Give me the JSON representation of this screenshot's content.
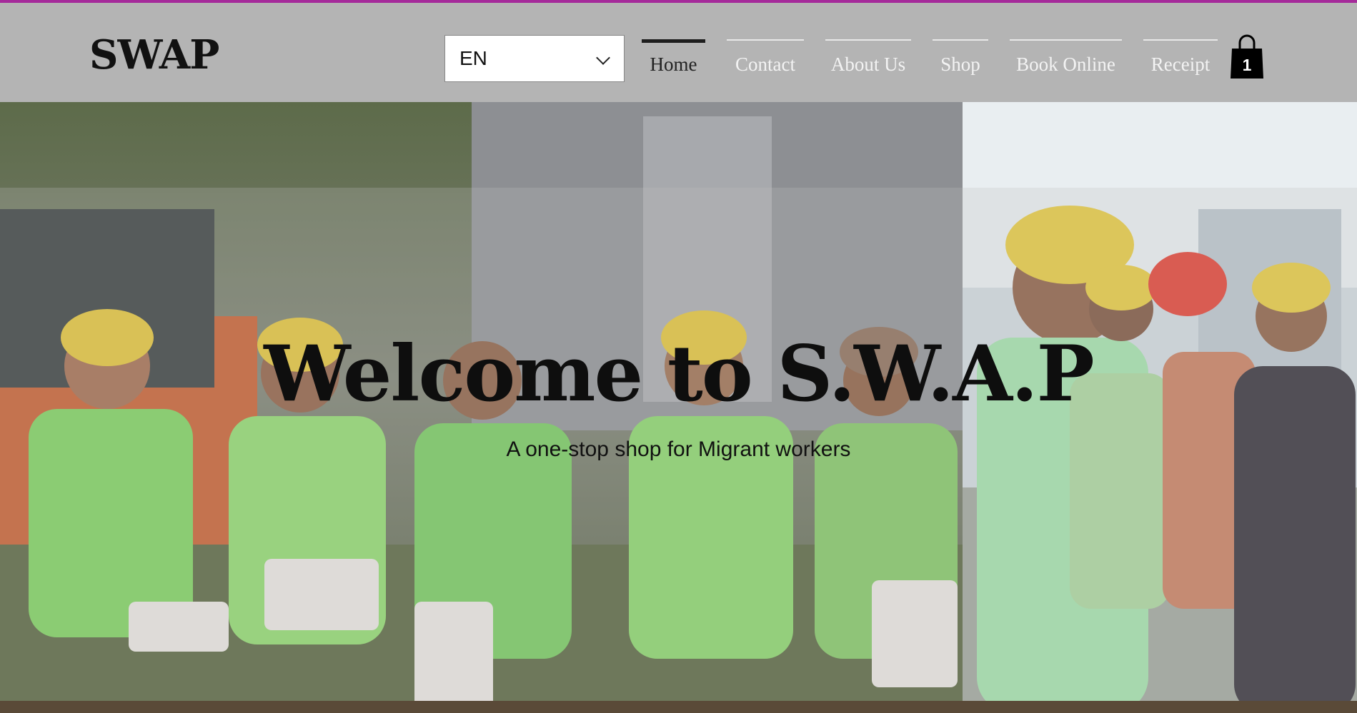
{
  "brand": {
    "logo_text": "SWAP",
    "accent_color": "#a52a9a"
  },
  "language": {
    "selected": "EN"
  },
  "nav": {
    "items": [
      {
        "label": "Home",
        "active": true
      },
      {
        "label": "Contact"
      },
      {
        "label": "About Us"
      },
      {
        "label": "Shop"
      },
      {
        "label": "Book Online"
      },
      {
        "label": "Receipt"
      }
    ]
  },
  "cart": {
    "count": "1",
    "icon": "shopping-bag-icon"
  },
  "hero": {
    "title": "Welcome to S.W.A.P",
    "subtitle": "A one-stop shop for Migrant workers",
    "image_left": "group of migrant workers in hard hats and safety vests holding towels and gifts",
    "image_right": "migrant workers in hard hats at construction site"
  }
}
